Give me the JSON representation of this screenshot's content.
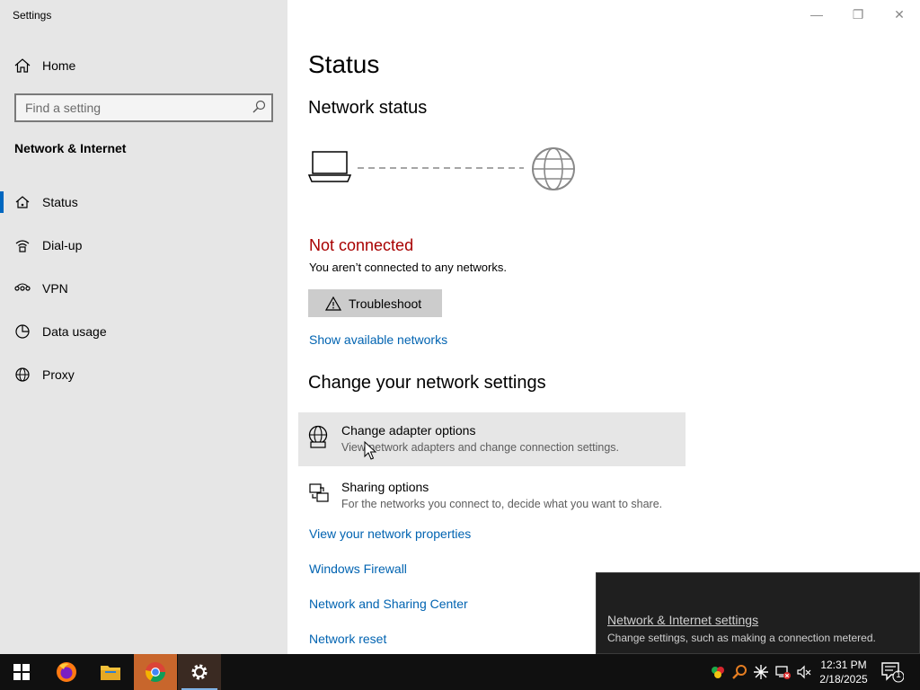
{
  "window": {
    "title": "Settings",
    "controls": {
      "minimize": "—",
      "restore": "❐",
      "close": "✕"
    }
  },
  "sidebar": {
    "home_label": "Home",
    "search_placeholder": "Find a setting",
    "section_title": "Network & Internet",
    "items": [
      {
        "label": "Status",
        "icon": "home-network-icon",
        "active": true
      },
      {
        "label": "Dial-up",
        "icon": "dialup-icon",
        "active": false
      },
      {
        "label": "VPN",
        "icon": "vpn-icon",
        "active": false
      },
      {
        "label": "Data usage",
        "icon": "data-usage-icon",
        "active": false
      },
      {
        "label": "Proxy",
        "icon": "globe-icon",
        "active": false
      }
    ]
  },
  "main": {
    "title": "Status",
    "network_status_heading": "Network status",
    "connection_state": "Not connected",
    "connection_detail": "You aren’t connected to any networks.",
    "troubleshoot_label": "Troubleshoot",
    "show_networks_link": "Show available networks",
    "change_settings_heading": "Change your network settings",
    "settings": [
      {
        "title": "Change adapter options",
        "desc": "View network adapters and change connection settings.",
        "icon": "adapter-globe-icon"
      },
      {
        "title": "Sharing options",
        "desc": "For the networks you connect to, decide what you want to share.",
        "icon": "sharing-icon"
      }
    ],
    "links": [
      "View your network properties",
      "Windows Firewall",
      "Network and Sharing Center",
      "Network reset"
    ]
  },
  "flyout": {
    "title": "Network & Internet settings",
    "desc": "Change settings, such as making a connection metered."
  },
  "taskbar": {
    "apps": [
      "start-icon",
      "firefox-icon",
      "file-explorer-icon",
      "chrome-icon",
      "settings-gear-icon"
    ],
    "time": "12:31 PM",
    "date": "2/18/2025",
    "notification_count": "1"
  },
  "colors": {
    "accent": "#0067c0",
    "link": "#0063b1",
    "error": "#a80000",
    "sidebar_bg": "#e6e6e6",
    "taskbar_bg": "#101010"
  }
}
